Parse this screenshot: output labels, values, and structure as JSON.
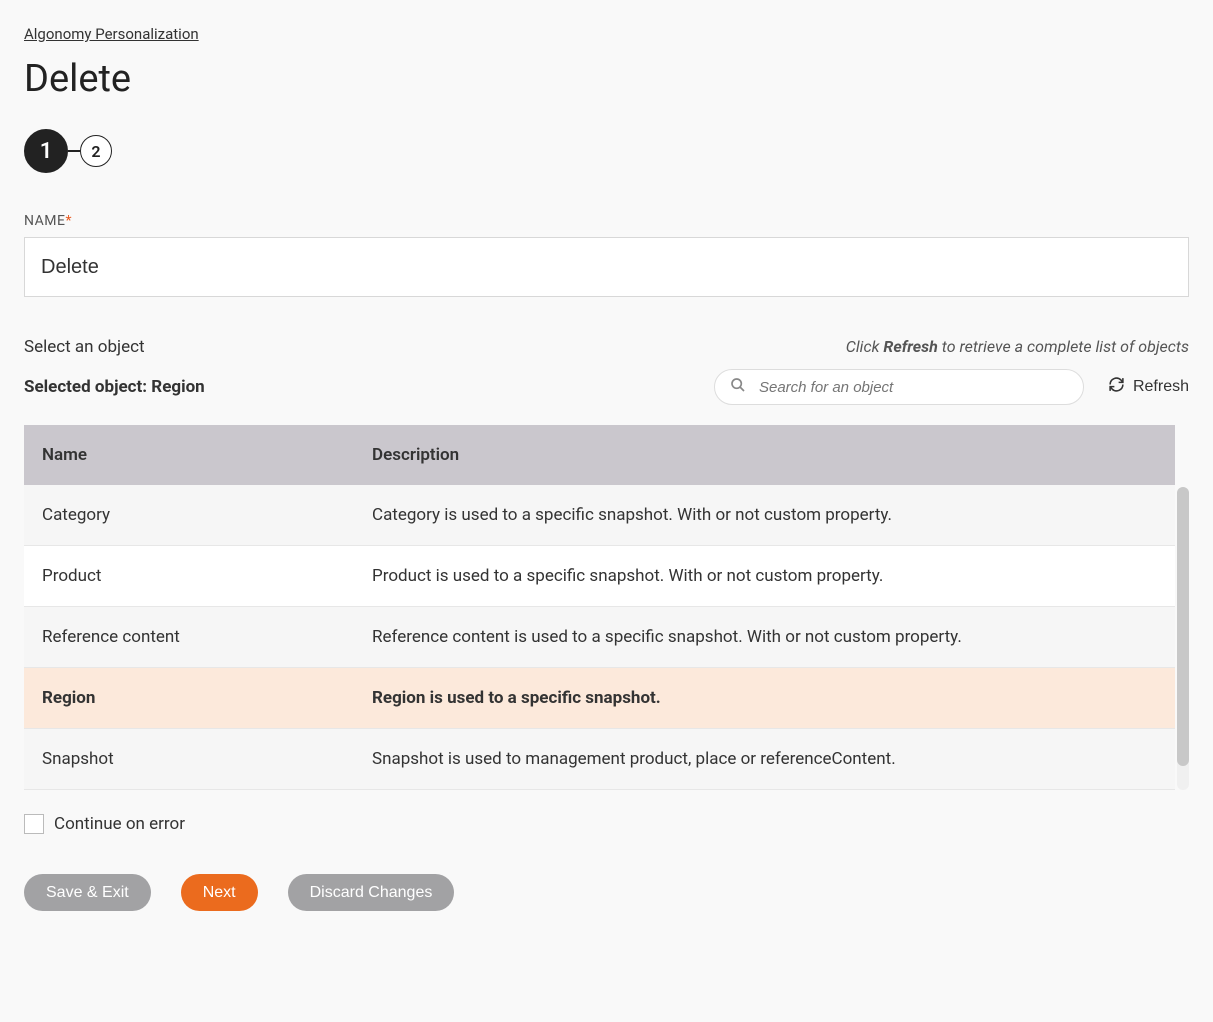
{
  "breadcrumb": "Algonomy Personalization",
  "page_title": "Delete",
  "stepper": {
    "step1": "1",
    "step2": "2"
  },
  "form": {
    "name_label": "NAME",
    "name_value": "Delete"
  },
  "object_section": {
    "select_label": "Select an object",
    "hint_pre": "Click ",
    "hint_bold": "Refresh",
    "hint_post": " to retrieve a complete list of objects",
    "selected_label": "Selected object: Region",
    "search_placeholder": "Search for an object",
    "refresh_label": "Refresh"
  },
  "table": {
    "headers": {
      "name": "Name",
      "description": "Description"
    },
    "rows": [
      {
        "name": "Category",
        "description": "Category is used to a specific snapshot. With or not custom property.",
        "selected": false
      },
      {
        "name": "Product",
        "description": "Product is used to a specific snapshot. With or not custom property.",
        "selected": false
      },
      {
        "name": "Reference content",
        "description": "Reference content is used to a specific snapshot. With or not custom property.",
        "selected": false
      },
      {
        "name": "Region",
        "description": "Region is used to a specific snapshot.",
        "selected": true
      },
      {
        "name": "Snapshot",
        "description": "Snapshot is used to management product, place or referenceContent.",
        "selected": false
      }
    ]
  },
  "continue_on_error_label": "Continue on error",
  "buttons": {
    "save_exit": "Save & Exit",
    "next": "Next",
    "discard": "Discard Changes"
  }
}
